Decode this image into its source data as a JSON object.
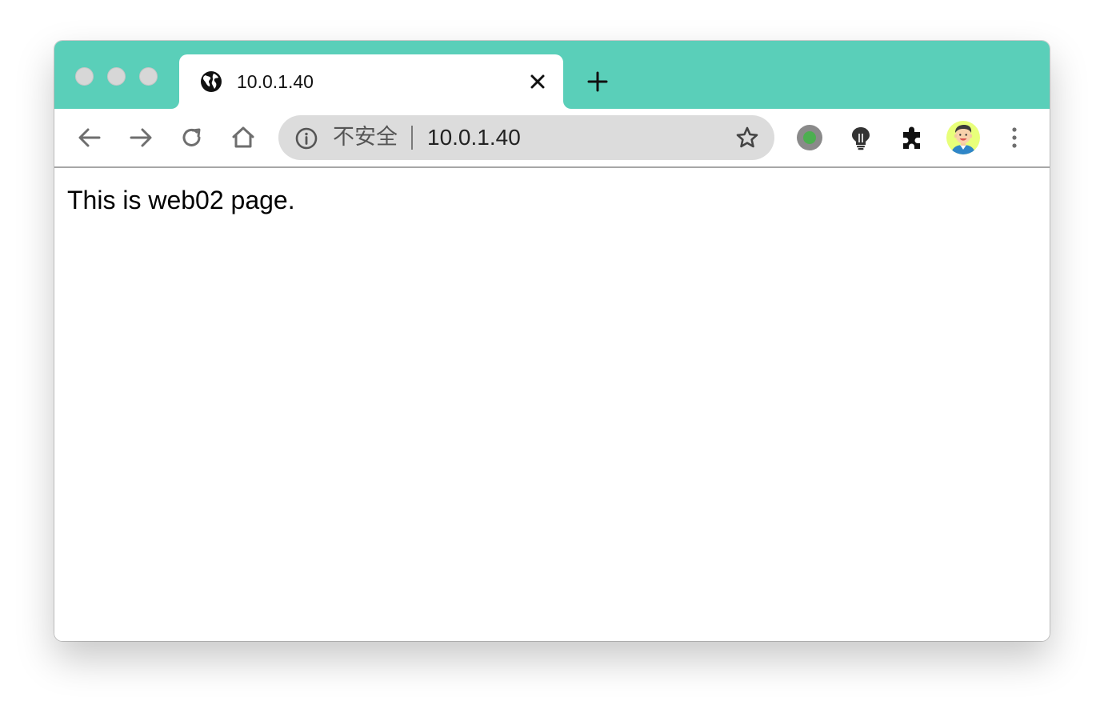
{
  "window": {
    "controls": [
      "close",
      "minimize",
      "zoom"
    ]
  },
  "tab": {
    "title": "10.0.1.40",
    "favicon": "globe-icon",
    "close_icon": "close-icon"
  },
  "new_tab_icon": "plus-icon",
  "toolbar": {
    "back_icon": "arrow-left-icon",
    "forward_icon": "arrow-right-icon",
    "reload_icon": "reload-icon",
    "home_icon": "home-icon"
  },
  "omnibox": {
    "info_icon": "info-icon",
    "security_label": "不安全",
    "url": "10.0.1.40",
    "bookmark_icon": "star-icon"
  },
  "extensions": [
    "record-indicator-icon",
    "lightbulb-icon",
    "puzzle-icon",
    "avatar",
    "more-vertical-icon"
  ],
  "page": {
    "text": "This is web02 page."
  },
  "colors": {
    "tab_strip": "#5acfb9",
    "omnibox_bg": "#dcdcdc",
    "record_dot": "#4caf50",
    "avatar_bg": "#e8ff7a"
  }
}
